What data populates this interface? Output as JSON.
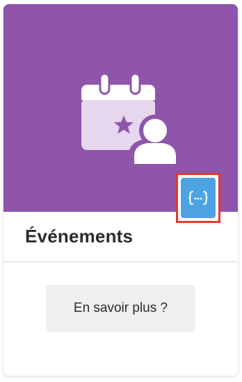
{
  "card": {
    "title": "Événements",
    "hero_icon": "calendar-star-person-icon",
    "api_badge_icon": "curly-braces-dots-icon",
    "api_badge_text": "{···}",
    "button_label": "En savoir plus ?"
  },
  "colors": {
    "hero_background": "#8e55ab",
    "badge_background": "#4ea3e3",
    "highlight_border": "#e23a2a",
    "button_background": "#efefef",
    "title_text": "#2c2c2c"
  }
}
